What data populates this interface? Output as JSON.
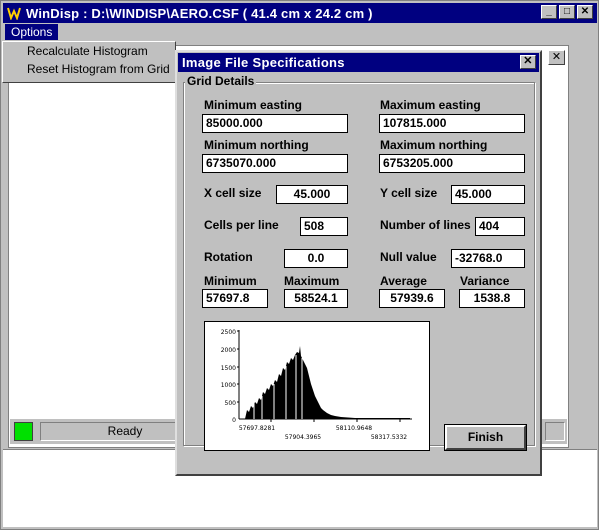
{
  "window": {
    "title": "WinDisp : D:\\WINDISP\\AERO.CSF ( 41.4 cm x 24.2 cm )",
    "minimize": "_",
    "maximize": "□",
    "close": "✕"
  },
  "menu": {
    "options": "Options",
    "items": [
      "Recalculate Histogram",
      "Reset Histogram from Grid"
    ]
  },
  "status": {
    "text": "Ready",
    "led_color": "#00e000"
  },
  "dialog": {
    "title": "Image File Specifications",
    "close": "✕",
    "group": "Grid Details",
    "min_easting_label": "Minimum easting",
    "min_easting": "85000.000",
    "max_easting_label": "Maximum easting",
    "max_easting": "107815.000",
    "min_northing_label": "Minimum northing",
    "min_northing": "6735070.000",
    "max_northing_label": "Maximum northing",
    "max_northing": "6753205.000",
    "x_cell_label": "X cell size",
    "x_cell": "45.000",
    "y_cell_label": "Y cell size",
    "y_cell": "45.000",
    "cells_per_line_label": "Cells per line",
    "cells_per_line": "508",
    "lines_label": "Number of lines",
    "lines": "404",
    "rotation_label": "Rotation",
    "rotation": "0.0",
    "null_label": "Null value",
    "null_value": "-32768.0",
    "minimum_label": "Minimum",
    "minimum": "57697.8",
    "maximum_label": "Maximum",
    "maximum": "58524.1",
    "average_label": "Average",
    "average": "57939.6",
    "variance_label": "Variance",
    "variance": "1538.8",
    "finish": "Finish"
  },
  "histogram": {
    "y_ticks": [
      "2500",
      "2000",
      "1500",
      "1000",
      "500",
      "0"
    ],
    "x_ticks": [
      "57697.8281",
      "57904.3965",
      "58110.9648",
      "58317.5332"
    ]
  }
}
